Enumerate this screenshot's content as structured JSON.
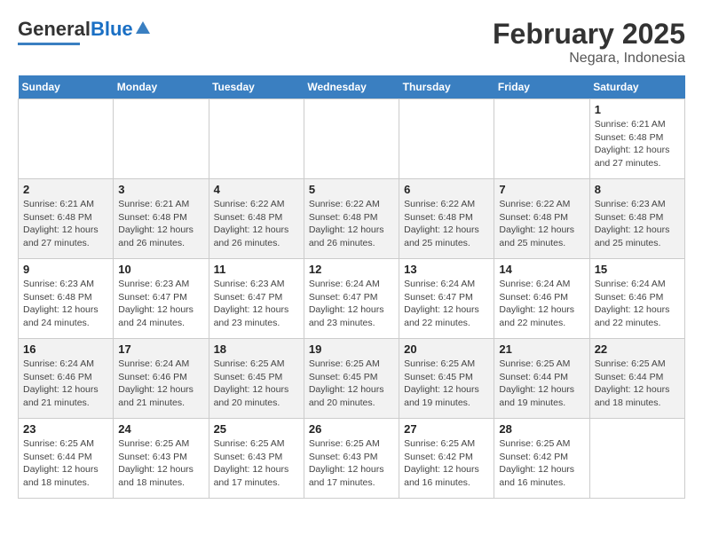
{
  "logo": {
    "part1": "General",
    "part2": "Blue"
  },
  "title": "February 2025",
  "subtitle": "Negara, Indonesia",
  "days_of_week": [
    "Sunday",
    "Monday",
    "Tuesday",
    "Wednesday",
    "Thursday",
    "Friday",
    "Saturday"
  ],
  "weeks": [
    [
      {
        "day": "",
        "detail": ""
      },
      {
        "day": "",
        "detail": ""
      },
      {
        "day": "",
        "detail": ""
      },
      {
        "day": "",
        "detail": ""
      },
      {
        "day": "",
        "detail": ""
      },
      {
        "day": "",
        "detail": ""
      },
      {
        "day": "1",
        "detail": "Sunrise: 6:21 AM\nSunset: 6:48 PM\nDaylight: 12 hours and 27 minutes."
      }
    ],
    [
      {
        "day": "2",
        "detail": "Sunrise: 6:21 AM\nSunset: 6:48 PM\nDaylight: 12 hours and 27 minutes."
      },
      {
        "day": "3",
        "detail": "Sunrise: 6:21 AM\nSunset: 6:48 PM\nDaylight: 12 hours and 26 minutes."
      },
      {
        "day": "4",
        "detail": "Sunrise: 6:22 AM\nSunset: 6:48 PM\nDaylight: 12 hours and 26 minutes."
      },
      {
        "day": "5",
        "detail": "Sunrise: 6:22 AM\nSunset: 6:48 PM\nDaylight: 12 hours and 26 minutes."
      },
      {
        "day": "6",
        "detail": "Sunrise: 6:22 AM\nSunset: 6:48 PM\nDaylight: 12 hours and 25 minutes."
      },
      {
        "day": "7",
        "detail": "Sunrise: 6:22 AM\nSunset: 6:48 PM\nDaylight: 12 hours and 25 minutes."
      },
      {
        "day": "8",
        "detail": "Sunrise: 6:23 AM\nSunset: 6:48 PM\nDaylight: 12 hours and 25 minutes."
      }
    ],
    [
      {
        "day": "9",
        "detail": "Sunrise: 6:23 AM\nSunset: 6:48 PM\nDaylight: 12 hours and 24 minutes."
      },
      {
        "day": "10",
        "detail": "Sunrise: 6:23 AM\nSunset: 6:47 PM\nDaylight: 12 hours and 24 minutes."
      },
      {
        "day": "11",
        "detail": "Sunrise: 6:23 AM\nSunset: 6:47 PM\nDaylight: 12 hours and 23 minutes."
      },
      {
        "day": "12",
        "detail": "Sunrise: 6:24 AM\nSunset: 6:47 PM\nDaylight: 12 hours and 23 minutes."
      },
      {
        "day": "13",
        "detail": "Sunrise: 6:24 AM\nSunset: 6:47 PM\nDaylight: 12 hours and 22 minutes."
      },
      {
        "day": "14",
        "detail": "Sunrise: 6:24 AM\nSunset: 6:46 PM\nDaylight: 12 hours and 22 minutes."
      },
      {
        "day": "15",
        "detail": "Sunrise: 6:24 AM\nSunset: 6:46 PM\nDaylight: 12 hours and 22 minutes."
      }
    ],
    [
      {
        "day": "16",
        "detail": "Sunrise: 6:24 AM\nSunset: 6:46 PM\nDaylight: 12 hours and 21 minutes."
      },
      {
        "day": "17",
        "detail": "Sunrise: 6:24 AM\nSunset: 6:46 PM\nDaylight: 12 hours and 21 minutes."
      },
      {
        "day": "18",
        "detail": "Sunrise: 6:25 AM\nSunset: 6:45 PM\nDaylight: 12 hours and 20 minutes."
      },
      {
        "day": "19",
        "detail": "Sunrise: 6:25 AM\nSunset: 6:45 PM\nDaylight: 12 hours and 20 minutes."
      },
      {
        "day": "20",
        "detail": "Sunrise: 6:25 AM\nSunset: 6:45 PM\nDaylight: 12 hours and 19 minutes."
      },
      {
        "day": "21",
        "detail": "Sunrise: 6:25 AM\nSunset: 6:44 PM\nDaylight: 12 hours and 19 minutes."
      },
      {
        "day": "22",
        "detail": "Sunrise: 6:25 AM\nSunset: 6:44 PM\nDaylight: 12 hours and 18 minutes."
      }
    ],
    [
      {
        "day": "23",
        "detail": "Sunrise: 6:25 AM\nSunset: 6:44 PM\nDaylight: 12 hours and 18 minutes."
      },
      {
        "day": "24",
        "detail": "Sunrise: 6:25 AM\nSunset: 6:43 PM\nDaylight: 12 hours and 18 minutes."
      },
      {
        "day": "25",
        "detail": "Sunrise: 6:25 AM\nSunset: 6:43 PM\nDaylight: 12 hours and 17 minutes."
      },
      {
        "day": "26",
        "detail": "Sunrise: 6:25 AM\nSunset: 6:43 PM\nDaylight: 12 hours and 17 minutes."
      },
      {
        "day": "27",
        "detail": "Sunrise: 6:25 AM\nSunset: 6:42 PM\nDaylight: 12 hours and 16 minutes."
      },
      {
        "day": "28",
        "detail": "Sunrise: 6:25 AM\nSunset: 6:42 PM\nDaylight: 12 hours and 16 minutes."
      },
      {
        "day": "",
        "detail": ""
      }
    ]
  ]
}
